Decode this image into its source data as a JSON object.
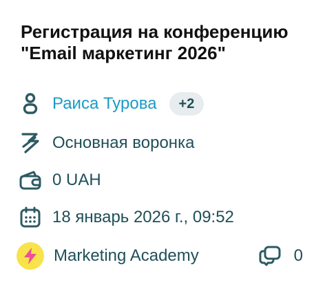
{
  "deal": {
    "title": "Регистрация на конференцию \"Email маркетинг 2026\""
  },
  "contact": {
    "icon": "person-icon",
    "name": "Раиса Турова",
    "extra_badge": "+2",
    "link_color": "#1a9bc6"
  },
  "pipeline": {
    "icon": "funnel-bolt-icon",
    "name": "Основная воронка"
  },
  "amount": {
    "icon": "wallet-icon",
    "value": "0 UAH"
  },
  "date": {
    "icon": "calendar-icon",
    "value": "18 январь 2026 г., 09:52"
  },
  "owner": {
    "icon": "lightning-icon",
    "avatar_color": "#f8e34a",
    "accent_color": "#f04e98",
    "name": "Marketing Academy"
  },
  "comments": {
    "icon": "comments-icon",
    "count": "0"
  }
}
